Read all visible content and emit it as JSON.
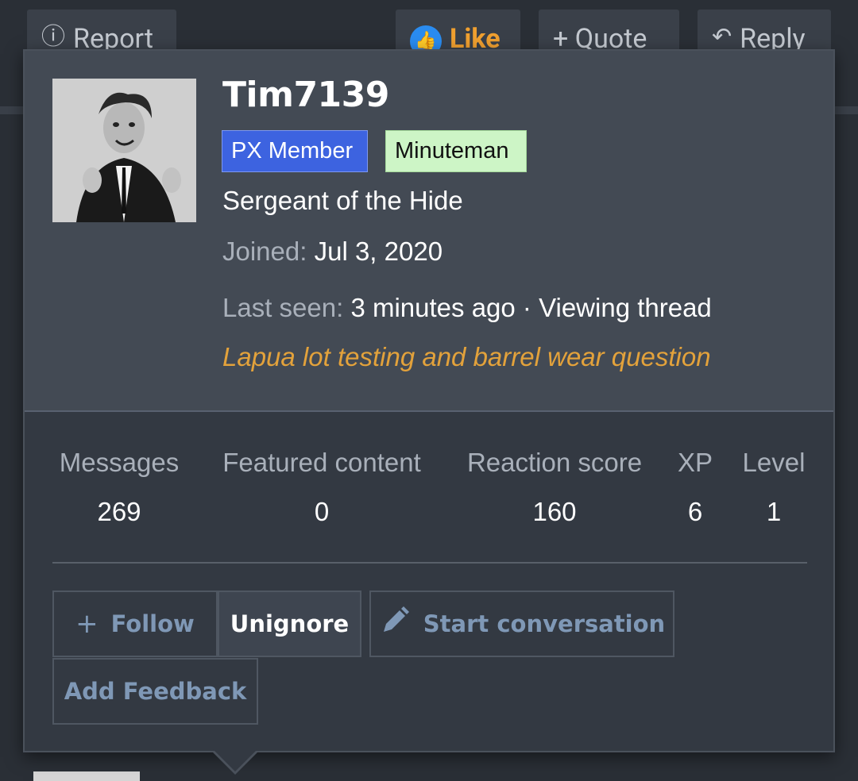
{
  "post_actions": {
    "report": "Report",
    "like": "Like",
    "quote": "+ Quote",
    "reply": "Reply"
  },
  "profile": {
    "username": "Tim7139",
    "avatar_alt": "avatar",
    "badges": [
      "PX Member",
      "Minuteman"
    ],
    "title": "Sergeant of the Hide",
    "joined_label": "Joined:",
    "joined_value": "Jul 3, 2020",
    "last_seen_label": "Last seen:",
    "last_seen_value": "3 minutes ago · Viewing thread",
    "viewing_thread": "Lapua lot testing and barrel wear question"
  },
  "stats": [
    {
      "label": "Messages",
      "value": "269"
    },
    {
      "label": "Featured content",
      "value": "0"
    },
    {
      "label": "Reaction score",
      "value": "160"
    },
    {
      "label": "XP",
      "value": "6"
    },
    {
      "label": "Level",
      "value": "1"
    }
  ],
  "buttons": {
    "follow": "Follow",
    "unignore": "Unignore",
    "start_conversation": "Start conversation",
    "add_feedback": "Add Feedback"
  },
  "colors": {
    "px_member": "#3d63e0",
    "minuteman": "#cdf5c6",
    "link_accent": "#e3a23b",
    "button_text": "#7f98b6"
  }
}
